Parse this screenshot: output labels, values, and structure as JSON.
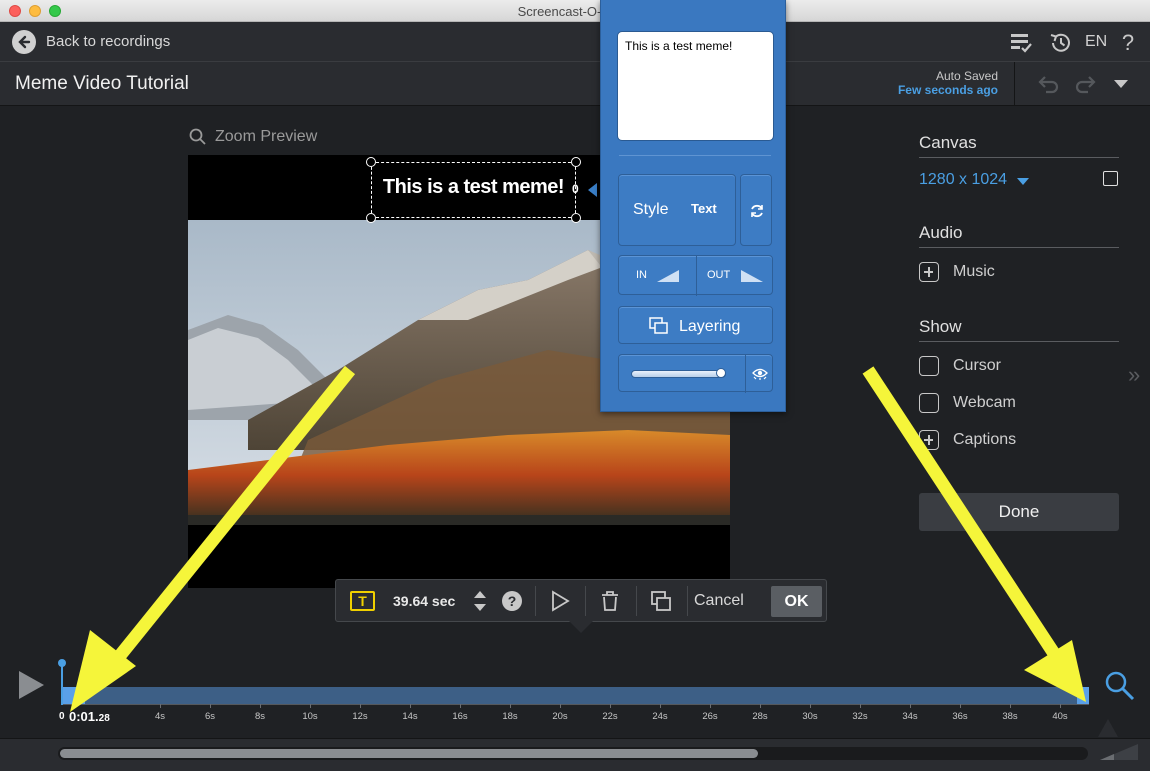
{
  "window": {
    "title": "Screencast-O-Matic"
  },
  "nav": {
    "back_label": "Back to recordings",
    "language": "EN"
  },
  "project": {
    "title": "Meme Video Tutorial",
    "autosave_label": "Auto Saved",
    "autosave_time": "Few seconds ago"
  },
  "preview": {
    "zoom_label": "Zoom Preview",
    "meme_text": "This is a test meme!",
    "rotation": "0"
  },
  "popup": {
    "text_value": "This is a test meme!",
    "style_label": "Style",
    "style_sample": "Text",
    "in_label": "IN",
    "out_label": "OUT",
    "layering_label": "Layering",
    "opacity": 0.95
  },
  "sidebar": {
    "canvas_heading": "Canvas",
    "canvas_size": "1280 x 1024",
    "audio_heading": "Audio",
    "music_label": "Music",
    "show_heading": "Show",
    "cursor_label": "Cursor",
    "webcam_label": "Webcam",
    "captions_label": "Captions",
    "done_label": "Done"
  },
  "toolbar": {
    "text_icon": "T",
    "duration": "39.64 sec",
    "cancel_label": "Cancel",
    "ok_label": "OK"
  },
  "timeline": {
    "start_label": "0",
    "current_time": "0:01.",
    "current_time_frac": "28",
    "ticks": [
      "4s",
      "6s",
      "8s",
      "10s",
      "12s",
      "14s",
      "16s",
      "18s",
      "20s",
      "22s",
      "24s",
      "26s",
      "28s",
      "30s",
      "32s",
      "34s",
      "36s",
      "38s",
      "40s"
    ],
    "scroll_fraction": 0.68
  },
  "colors": {
    "accent": "#4a9fe3",
    "popup": "#3a78c0",
    "annotation_arrow": "#f5f53a"
  }
}
